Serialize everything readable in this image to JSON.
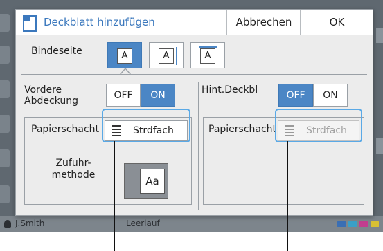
{
  "dialog": {
    "title": "Deckblatt hinzufügen",
    "cancel_label": "Abbrechen",
    "ok_label": "OK"
  },
  "binding": {
    "label": "Bindeseite",
    "options": [
      {
        "glyph": "A",
        "edge": "left",
        "selected": true
      },
      {
        "glyph": "A",
        "edge": "right",
        "selected": false
      },
      {
        "glyph": "A",
        "edge": "top",
        "selected": false
      }
    ]
  },
  "front_cover": {
    "label": "Vordere Abdeckung",
    "off_label": "OFF",
    "on_label": "ON",
    "state": "ON",
    "tray_label": "Papierschacht",
    "tray_value": "Strdfach",
    "feed_label": "Zufuhr-methode",
    "feed_glyph": "Aa"
  },
  "back_cover": {
    "label": "Hint.Deckbl",
    "off_label": "OFF",
    "on_label": "ON",
    "state": "OFF",
    "tray_label": "Papierschacht",
    "tray_value": "Strdfach"
  },
  "background": {
    "status_user": "J.Smith",
    "status_text": "Leerlauf"
  },
  "colors": {
    "accent": "#4b86c5",
    "title_text": "#3b78bd",
    "highlight": "#5aa9e6",
    "dialog_bg": "#ececec"
  },
  "icons": [
    "document-icon",
    "binding-left-icon",
    "binding-right-icon",
    "binding-top-icon",
    "paper-tray-icon",
    "feed-method-icon",
    "user-icon"
  ]
}
